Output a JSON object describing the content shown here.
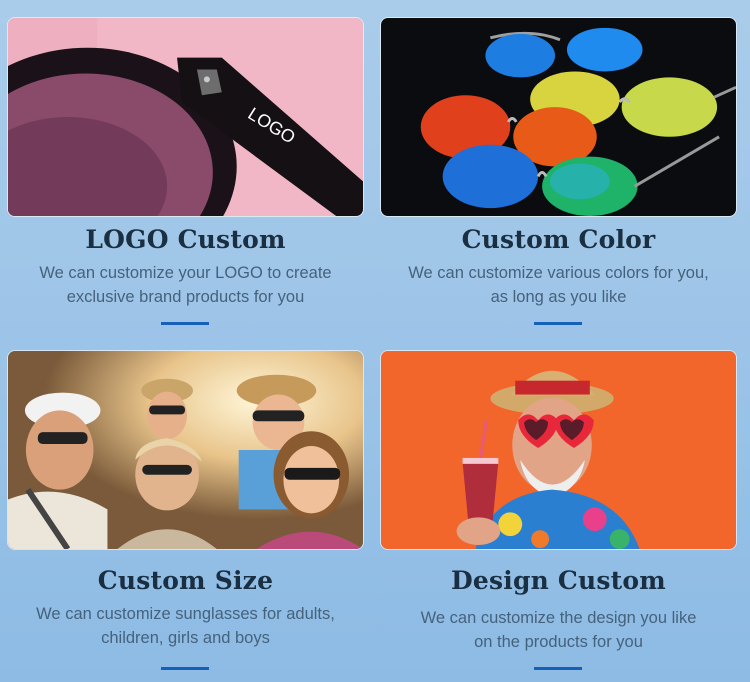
{
  "cards": [
    {
      "title": "LOGO Custom",
      "desc_line1": "We can customize your LOGO to create",
      "desc_line2": "exclusive brand products for you",
      "photo_text": "LOGO"
    },
    {
      "title": "Custom Color",
      "desc_line1": "We can customize various colors for you,",
      "desc_line2": "as long as you like"
    },
    {
      "title": "Custom Size",
      "desc_line1": "We can customize sunglasses for adults,",
      "desc_line2": "children, girls and boys"
    },
    {
      "title": "Design Custom",
      "desc_line1": "We can customize the design you like",
      "desc_line2": "on the products for you"
    }
  ],
  "colors": {
    "accent_bar": "#1660b8",
    "title": "#1a2f42",
    "description": "#45627d"
  }
}
